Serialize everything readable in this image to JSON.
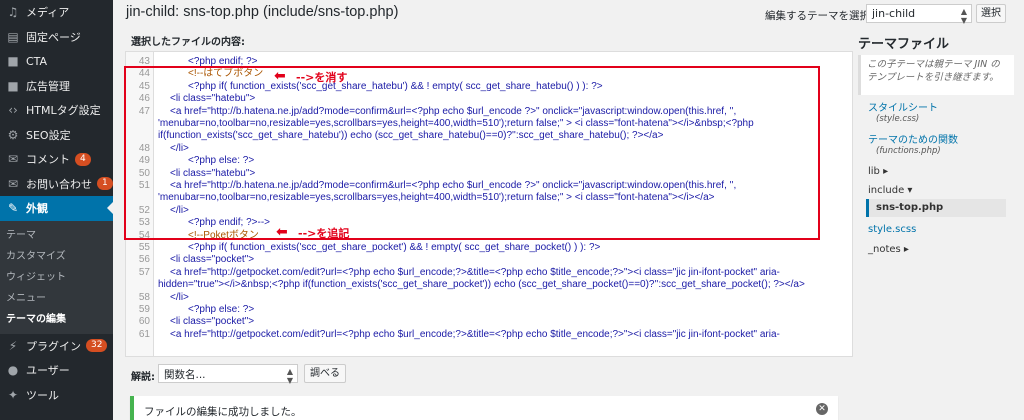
{
  "sidebar": {
    "items": [
      {
        "label": "メディア",
        "icon": "media-icon",
        "glyph": "♫"
      },
      {
        "label": "固定ページ",
        "icon": "page-icon",
        "glyph": "▤"
      },
      {
        "label": "CTA",
        "icon": "cta-icon",
        "glyph": "■"
      },
      {
        "label": "広告管理",
        "icon": "ad-icon",
        "glyph": "■"
      },
      {
        "label": "HTMLタグ設定",
        "icon": "code-icon",
        "glyph": "‹›"
      },
      {
        "label": "SEO設定",
        "icon": "gear-icon",
        "glyph": "⚙"
      },
      {
        "label": "コメント",
        "icon": "comment-icon",
        "glyph": "✉",
        "badge": "4"
      },
      {
        "label": "お問い合わせ",
        "icon": "mail-icon",
        "glyph": "✉",
        "badge": "1"
      }
    ],
    "appearance": {
      "label": "外観",
      "icon": "brush-icon",
      "glyph": "✎"
    },
    "submenu": [
      "テーマ",
      "カスタマイズ",
      "ウィジェット",
      "メニュー",
      "テーマの編集"
    ],
    "bottom_items": [
      {
        "label": "プラグイン",
        "icon": "plugin-icon",
        "glyph": "⚡",
        "badge": "32"
      },
      {
        "label": "ユーザー",
        "icon": "user-icon",
        "glyph": "●"
      },
      {
        "label": "ツール",
        "icon": "wrench-icon",
        "glyph": "✦"
      }
    ]
  },
  "header": {
    "title": "jin-child: sns-top.php (include/sns-top.php)",
    "select_label": "編集するテーマを選択:",
    "select_value": "jin-child",
    "select_button": "選択"
  },
  "editor": {
    "content_label": "選択したファイルの内容:",
    "lines": [
      {
        "n": "43",
        "t": "<?php endif; ?>"
      },
      {
        "n": "44",
        "t": "<!--はてブボタン"
      },
      {
        "n": "45",
        "t": "<?php if( function_exists('scc_get_share_hatebu') && ! empty( scc_get_share_hatebu() ) ): ?>"
      },
      {
        "n": "46",
        "t": "    <li class=\"hatebu\">"
      },
      {
        "n": "47",
        "t": "    <a href=\"http://b.hatena.ne.jp/add?mode=confirm&url=<?php echo $url_encode ?>\" onclick=\"javascript:window.open(this.href, '',"
      },
      {
        "n": "",
        "t": "'menubar=no,toolbar=no,resizable=yes,scrollbars=yes,height=400,width=510');return false;\" > <i class=\"font-hatena\"></i>&nbsp;<?php"
      },
      {
        "n": "",
        "t": "if(function_exists('scc_get_share_hatebu')) echo (scc_get_share_hatebu()==0)?'':scc_get_share_hatebu(); ?></a>"
      },
      {
        "n": "48",
        "t": "    </li>"
      },
      {
        "n": "49",
        "t": "<?php else: ?>"
      },
      {
        "n": "50",
        "t": "    <li class=\"hatebu\">"
      },
      {
        "n": "51",
        "t": "    <a href=\"http://b.hatena.ne.jp/add?mode=confirm&url=<?php echo $url_encode ?>\" onclick=\"javascript:window.open(this.href, '',"
      },
      {
        "n": "",
        "t": "'menubar=no,toolbar=no,resizable=yes,scrollbars=yes,height=400,width=510');return false;\" > <i class=\"font-hatena\"></i></a>"
      },
      {
        "n": "52",
        "t": "    </li>"
      },
      {
        "n": "53",
        "t": "<?php endif; ?>-->"
      },
      {
        "n": "54",
        "t": "<!--Poketボタン"
      },
      {
        "n": "55",
        "t": "<?php if( function_exists('scc_get_share_pocket') && ! empty( scc_get_share_pocket() ) ): ?>"
      },
      {
        "n": "56",
        "t": "    <li class=\"pocket\">"
      },
      {
        "n": "57",
        "t": "    <a href=\"http://getpocket.com/edit?url=<?php echo $url_encode;?>&title=<?php echo $title_encode;?>\"><i class=\"jic jin-ifont-pocket\" aria-"
      },
      {
        "n": "",
        "t": "hidden=\"true\"></i>&nbsp;<?php if(function_exists('scc_get_share_pocket')) echo (scc_get_share_pocket()==0)?'':scc_get_share_pocket(); ?></a>"
      },
      {
        "n": "58",
        "t": "    </li>"
      },
      {
        "n": "59",
        "t": "<?php else: ?>"
      },
      {
        "n": "60",
        "t": "    <li class=\"pocket\">"
      },
      {
        "n": "61",
        "t": "    <a href=\"http://getpocket.com/edit?url=<?php echo $url_encode;?>&title=<?php echo $title_encode;?>\"><i class=\"jic jin-ifont-pocket\" aria-"
      }
    ],
    "annotation_1": "-->を消す",
    "annotation_2": "-->を追記"
  },
  "theme_files": {
    "title": "テーマファイル",
    "description": "この子テーマは親テーマ JIN のテンプレートを引き継ぎます。",
    "stylesheet": "スタイルシート",
    "stylesheet_file": "(style.css)",
    "functions": "テーマのための関数",
    "functions_file": "(functions.php)",
    "lib": "lib ▸",
    "include": "include ▾",
    "current": "sns-top.php",
    "style_scss": "style.scss",
    "notes": "_notes ▸"
  },
  "bottom": {
    "docs_label": "解説:",
    "docs_select": "関数名...",
    "docs_button": "調べる",
    "notice": "ファイルの編集に成功しました。"
  },
  "colors": {
    "sidebar_bg": "#23282d",
    "active": "#0073aa",
    "badge": "#d54e21",
    "annotation": "#e2001a",
    "notice_border": "#46b450"
  }
}
